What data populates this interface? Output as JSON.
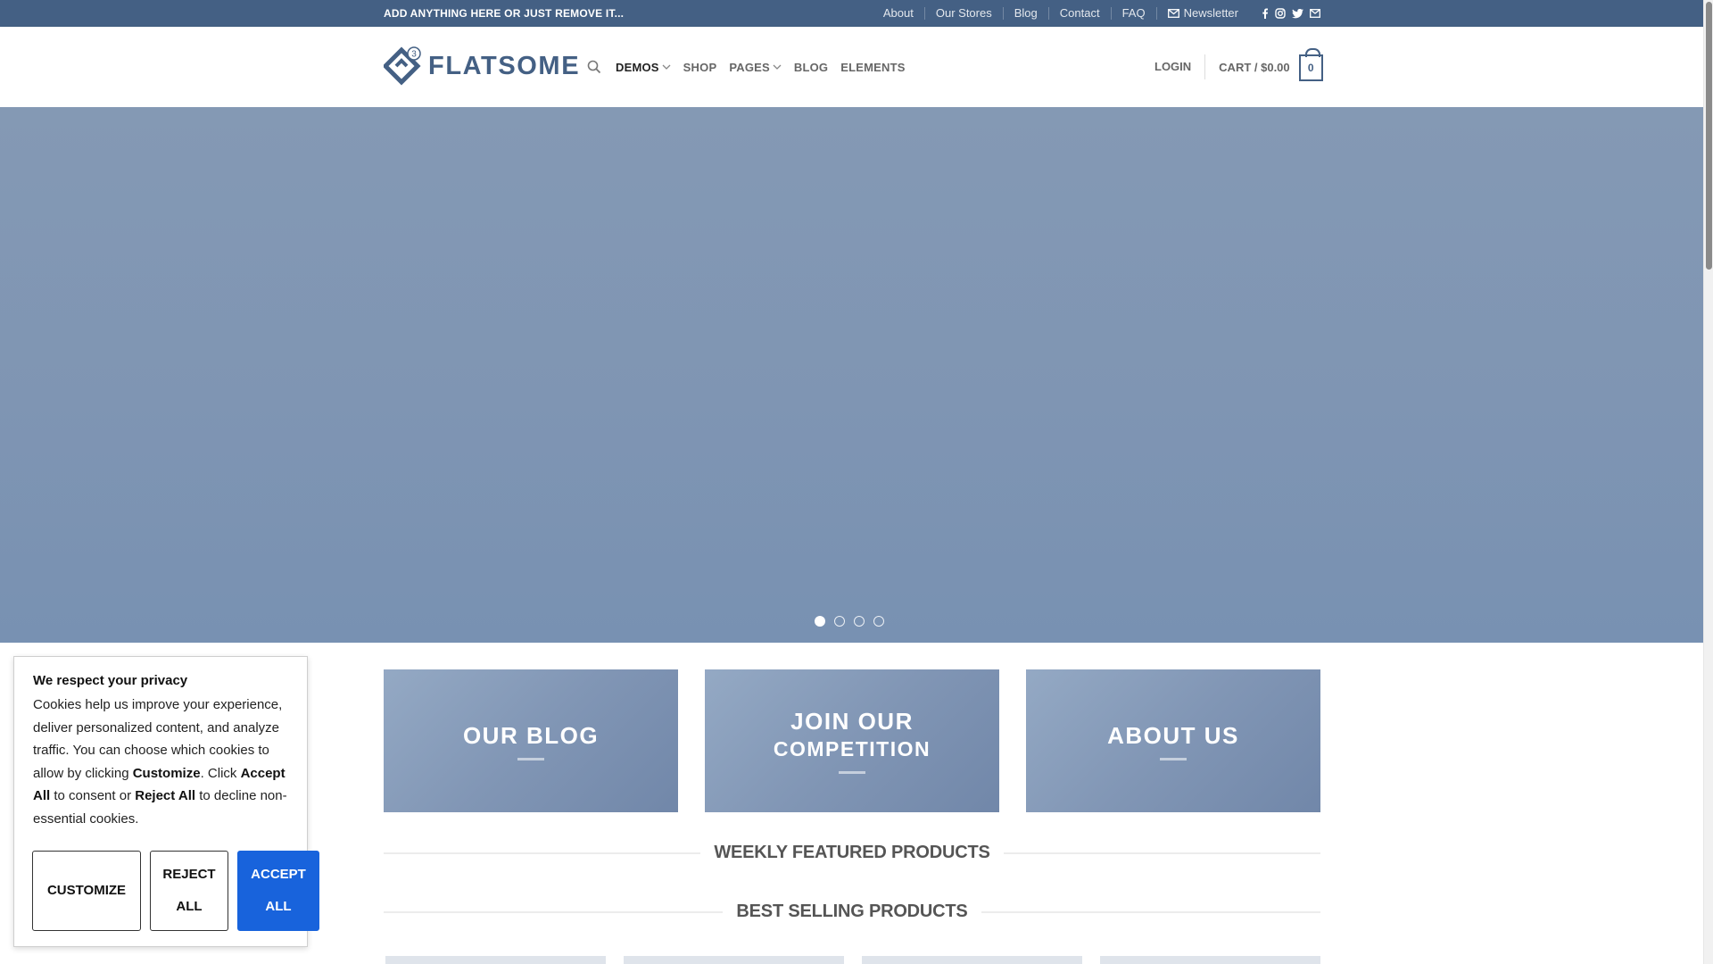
{
  "topbar": {
    "message": "ADD ANYTHING HERE OR JUST REMOVE IT...",
    "links": [
      "About",
      "Our Stores",
      "Blog",
      "Contact",
      "FAQ"
    ],
    "newsletter": "Newsletter"
  },
  "header": {
    "logo_text": "FLATSOME",
    "logo_badge": "3",
    "nav": {
      "demos": "DEMOS",
      "shop": "SHOP",
      "pages": "PAGES",
      "blog": "BLOG",
      "elements": "ELEMENTS"
    },
    "login": "LOGIN",
    "cart_label": "CART / $0.00",
    "cart_count": "0"
  },
  "hero": {
    "slides": 4,
    "active_slide": 1
  },
  "banners": {
    "blog": "OUR BLOG",
    "competition_line1": "JOIN OUR",
    "competition_line2": "COMPETITION",
    "about": "ABOUT US"
  },
  "sections": {
    "weekly": "WEEKLY FEATURED PRODUCTS",
    "best": "BEST SELLING PRODUCTS"
  },
  "cookie": {
    "title": "We respect your privacy",
    "text_1": "Cookies help us improve your experience, deliver personalized content, and analyze traffic. You can choose which cookies to allow by clicking ",
    "customize_word": "Customize",
    "text_2": ". Click ",
    "accept_word": "Accept All",
    "text_3": " to consent or ",
    "reject_word": "Reject All",
    "text_4": " to decline non-essential cookies.",
    "btn_customize": "CUSTOMIZE",
    "btn_reject": "REJECT ALL",
    "btn_accept": "ACCEPT ALL"
  },
  "colors": {
    "primary": "#446084",
    "accept": "#1863dc"
  }
}
